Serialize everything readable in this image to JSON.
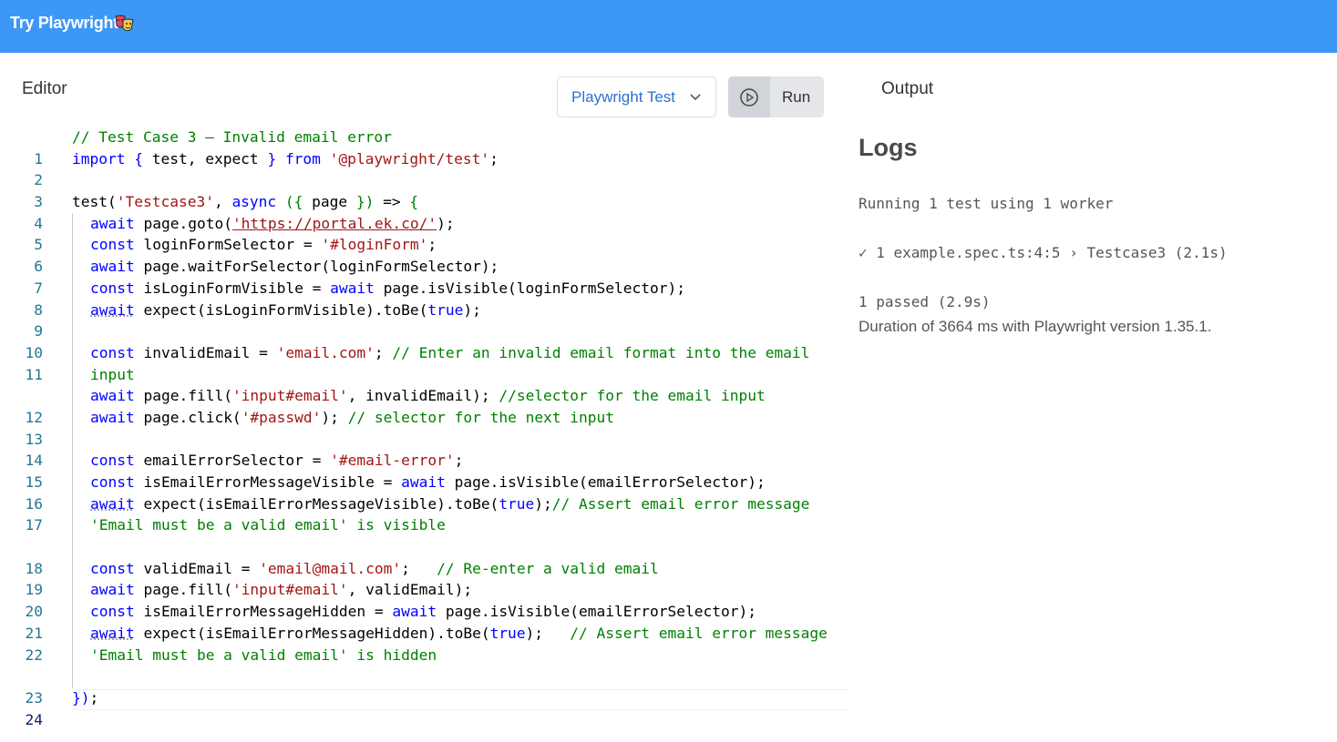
{
  "header": {
    "title": "Try Playwright",
    "logo_icon": "theater-masks-icon",
    "background_color": "#3d97f5"
  },
  "editor": {
    "label": "Editor",
    "language_select": {
      "selected": "Playwright Test"
    },
    "run_button": {
      "label": "Run",
      "icon": "play-circle-icon"
    },
    "lines": [
      {
        "n": "1"
      },
      {
        "n": "2"
      },
      {
        "n": "3"
      },
      {
        "n": "4"
      },
      {
        "n": "5"
      },
      {
        "n": "6"
      },
      {
        "n": "7"
      },
      {
        "n": "8"
      },
      {
        "n": "9"
      },
      {
        "n": "10"
      },
      {
        "n": "11"
      },
      {
        "n": "12"
      },
      {
        "n": "13"
      },
      {
        "n": "14"
      },
      {
        "n": "15"
      },
      {
        "n": "16"
      },
      {
        "n": "17"
      },
      {
        "n": "18"
      },
      {
        "n": "19"
      },
      {
        "n": "20"
      },
      {
        "n": "21"
      },
      {
        "n": "22"
      },
      {
        "n": "23"
      },
      {
        "n": "24"
      }
    ],
    "code": {
      "l1_comment": "// Test Case 3 – Invalid email error",
      "l2_import": "import",
      "l2_brace_open": "{",
      "l2_names": " test, expect ",
      "l2_brace_close": "}",
      "l2_from": "from",
      "l2_module": "'@playwright/test'",
      "l2_semi": ";",
      "l4_test": "test(",
      "l4_name": "'Testcase3'",
      "l4_comma": ", ",
      "l4_async": "async",
      "l4_params_open": "({",
      "l4_page": " page ",
      "l4_params_close": "})",
      "l4_arrow": " => ",
      "l4_body_open": "{",
      "await": "await",
      "const": "const",
      "l5_call": " page.goto(",
      "l5_url": "'https://portal.ek.co/'",
      "l5_end": ");",
      "l6_decl": " loginFormSelector = ",
      "l6_str": "'#loginForm'",
      "l6_end": ";",
      "l7_call": " page.waitForSelector(loginFormSelector);",
      "l8_decl": " isLoginFormVisible = ",
      "l8_call": " page.isVisible(loginFormSelector);",
      "l9_call": " expect(isLoginFormVisible).toBe(",
      "true": "true",
      "l9_end": ");",
      "l11_decl": " invalidEmail = ",
      "l11_str": "'email.com'",
      "l11_semi": "; ",
      "l11_comment": "// Enter an invalid email format into the email",
      "l11_comment_wrap": "input",
      "l12_call": " page.fill(",
      "l12_str": "'input#email'",
      "l12_rest": ", invalidEmail); ",
      "l12_comment": "//selector for the email input",
      "l13_call": " page.click(",
      "l13_str": "'#passwd'",
      "l13_rest": "); ",
      "l13_comment": "// selector for the next input",
      "l15_decl": " emailErrorSelector = ",
      "l15_str": "'#email-error'",
      "l15_end": ";",
      "l16_decl": " isEmailErrorMessageVisible = ",
      "l16_call": " page.isVisible(emailErrorSelector);",
      "l17_call": " expect(isEmailErrorMessageVisible).toBe(",
      "l17_end": ");",
      "l17_comment": "// Assert email error message",
      "l17_comment_wrap": "'Email must be a valid email' is visible",
      "l19_decl": " validEmail = ",
      "l19_str": "'email@mail.com'",
      "l19_semi": ";   ",
      "l19_comment": "// Re-enter a valid email",
      "l20_call": " page.fill(",
      "l20_str": "'input#email'",
      "l20_rest": ", validEmail);",
      "l21_decl": " isEmailErrorMessageHidden = ",
      "l21_call": " page.isVisible(emailErrorSelector);",
      "l22_call": " expect(isEmailErrorMessageHidden).toBe(",
      "l22_end": ");   ",
      "l22_comment": "// Assert email error message",
      "l22_comment_wrap": "'Email must be a valid email' is hidden",
      "l24_close": "})",
      "l24_semi": ";"
    }
  },
  "output": {
    "label": "Output",
    "logs_title": "Logs",
    "log_running": "Running 1 test using 1 worker",
    "log_result": "✓ 1 example.spec.ts:4:5 › Testcase3 (2.1s)",
    "log_passed": "1 passed (2.9s)",
    "log_duration": "Duration of 3664 ms with Playwright version 1.35.1."
  }
}
